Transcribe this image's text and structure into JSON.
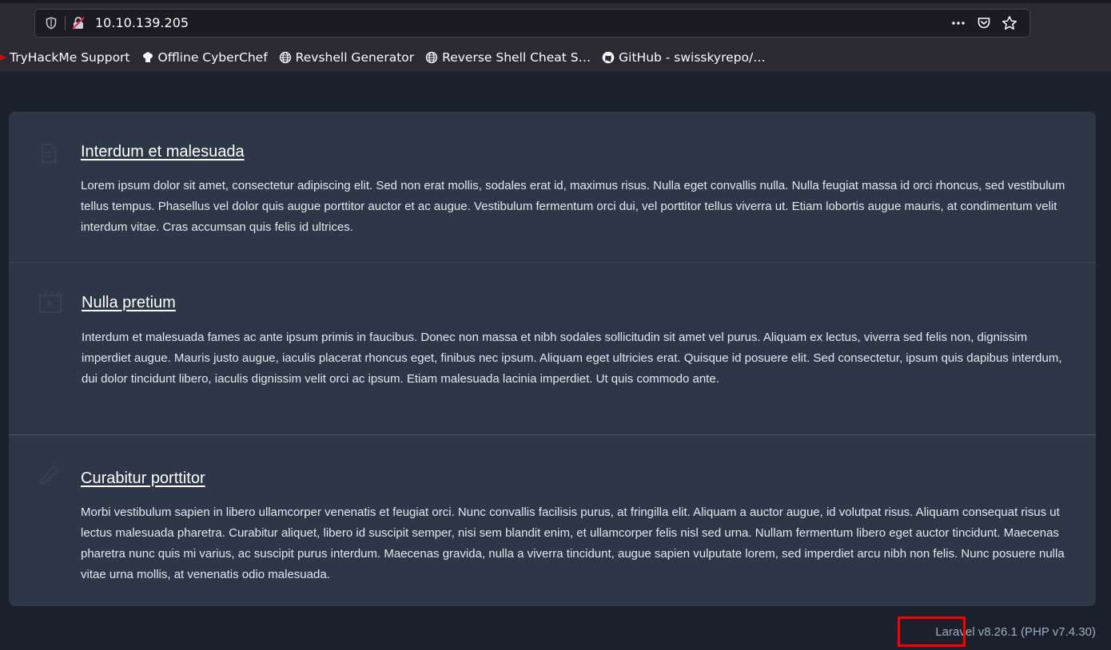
{
  "browser": {
    "url": "10.10.139.205",
    "actions": [
      "more-actions",
      "pocket",
      "bookmark-star"
    ],
    "bookmarks": [
      {
        "label": "TryHackMe Support",
        "icon": "thm-icon"
      },
      {
        "label": "Offline CyberChef",
        "icon": "chef-hat-icon"
      },
      {
        "label": "Revshell Generator",
        "icon": "globe-icon"
      },
      {
        "label": "Reverse Shell Cheat S…",
        "icon": "globe-icon"
      },
      {
        "label": "GitHub - swisskyrepo/…",
        "icon": "github-icon"
      }
    ]
  },
  "page": {
    "sections": [
      {
        "icon": "document-icon",
        "title": "Interdum et malesuada",
        "text": "Lorem ipsum dolor sit amet, consectetur adipiscing elit. Sed non erat mollis, sodales erat id, maximus risus. Nulla eget convallis nulla. Nulla feugiat massa id orci rhoncus, sed vestibulum tellus tempus. Phasellus vel dolor quis augue porttitor auctor et ac augue. Vestibulum fermentum orci dui, vel porttitor tellus viverra ut. Etiam lobortis augue mauris, at condimentum velit interdum vitae. Cras accumsan quis felis id ultrices."
      },
      {
        "icon": "video-icon",
        "title": "Nulla pretium",
        "text": "Interdum et malesuada fames ac ante ipsum primis in faucibus. Donec non massa et nibh sodales sollicitudin sit amet vel purus. Aliquam ex lectus, viverra sed felis non, dignissim imperdiet augue. Mauris justo augue, iaculis placerat rhoncus eget, finibus nec ipsum. Aliquam eget ultricies erat. Quisque id posuere elit. Sed consectetur, ipsum quis dapibus interdum, dui dolor tincidunt libero, iaculis dignissim velit orci ac ipsum. Etiam malesuada lacinia imperdiet. Ut quis commodo ante."
      },
      {
        "icon": "pencil-icon",
        "title": "Curabitur porttitor",
        "text": "Morbi vestibulum sapien in libero ullamcorper venenatis et feugiat orci. Nunc convallis facilisis purus, at fringilla elit. Aliquam a auctor augue, id volutpat risus. Aliquam consequat risus ut lectus malesuada pharetra. Curabitur aliquet, libero id suscipit semper, nisi sem blandit enim, et ullamcorper felis nisl sed urna. Nullam fermentum libero eget auctor tincidunt. Maecenas pharetra nunc quis mi varius, ac suscipit purus interdum. Maecenas gravida, nulla a viverra tincidunt, augue sapien vulputate lorem, sed imperdiet arcu nibh non felis. Nunc posuere nulla vitae urna mollis, at venenatis odio malesuada."
      }
    ],
    "footer": "Laravel v8.26.1 (PHP v7.4.30)"
  },
  "colors": {
    "page_bg": "#1a202c",
    "card_bg": "#2d3748",
    "highlight": "#ff0000"
  }
}
